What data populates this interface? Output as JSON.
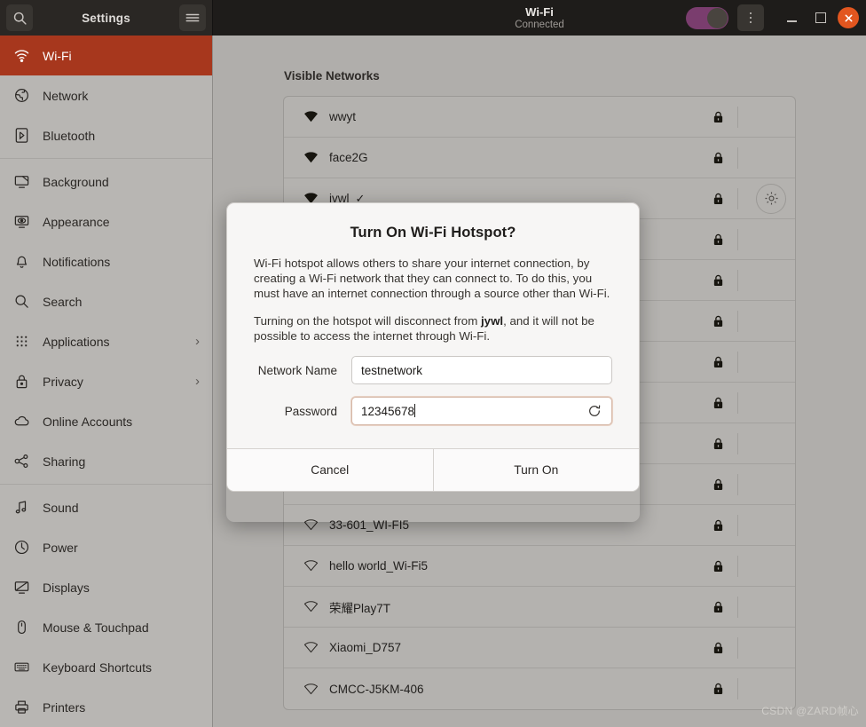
{
  "titlebar": {
    "app_title": "Settings",
    "search_icon": "search-icon",
    "menu_icon": "hamburger-icon",
    "page_title": "Wi-Fi",
    "page_subtitle": "Connected",
    "toggle_state": "on",
    "toggle_color": "#7a3d6e",
    "more_icon": "kebab-menu-icon",
    "minimize_icon": "minimize-icon",
    "maximize_icon": "maximize-icon",
    "close_icon": "close-icon",
    "close_color": "#e2561f"
  },
  "sidebar": {
    "selected": "Wi-Fi",
    "selected_color": "#a7371d",
    "items": [
      {
        "label": "Wi-Fi",
        "icon": "wifi-icon",
        "selected": true
      },
      {
        "label": "Network",
        "icon": "globe-icon"
      },
      {
        "label": "Bluetooth",
        "icon": "bluetooth-icon"
      },
      {
        "separator": true
      },
      {
        "label": "Background",
        "icon": "background-monitor-icon"
      },
      {
        "label": "Appearance",
        "icon": "appearance-icon"
      },
      {
        "label": "Notifications",
        "icon": "bell-icon"
      },
      {
        "label": "Search",
        "icon": "search-icon"
      },
      {
        "label": "Applications",
        "icon": "grid-dots-icon",
        "chevron": "›"
      },
      {
        "label": "Privacy",
        "icon": "lock-icon",
        "chevron": "›"
      },
      {
        "label": "Online Accounts",
        "icon": "cloud-icon"
      },
      {
        "label": "Sharing",
        "icon": "share-nodes-icon"
      },
      {
        "separator": true
      },
      {
        "label": "Sound",
        "icon": "music-note-icon"
      },
      {
        "label": "Power",
        "icon": "power-icon"
      },
      {
        "label": "Displays",
        "icon": "displays-icon"
      },
      {
        "label": "Mouse & Touchpad",
        "icon": "mouse-icon"
      },
      {
        "label": "Keyboard Shortcuts",
        "icon": "keyboard-icon"
      },
      {
        "label": "Printers",
        "icon": "printer-icon"
      }
    ]
  },
  "main": {
    "section_title": "Visible Networks",
    "networks": [
      {
        "name": "wwyt",
        "signal": "strong",
        "secured": true,
        "connected": false
      },
      {
        "name": "face2G",
        "signal": "strong",
        "secured": true,
        "connected": false
      },
      {
        "name": "jvwl",
        "signal": "strong",
        "secured": true,
        "connected": true,
        "check": "✓",
        "settings_icon": "gear-icon"
      },
      {
        "name": "",
        "signal": "strong",
        "secured": true,
        "connected": false
      },
      {
        "name": "",
        "signal": "strong",
        "secured": true,
        "connected": false
      },
      {
        "name": "",
        "signal": "strong",
        "secured": true,
        "connected": false
      },
      {
        "name": "",
        "signal": "weak",
        "secured": true,
        "connected": false
      },
      {
        "name": "",
        "signal": "weak",
        "secured": true,
        "connected": false
      },
      {
        "name": "",
        "signal": "weak",
        "secured": true,
        "connected": false
      },
      {
        "name": "",
        "signal": "weak",
        "secured": true,
        "connected": false
      },
      {
        "name": "33-601_WI-FI5",
        "signal": "weak",
        "secured": true,
        "connected": false
      },
      {
        "name": "hello world_Wi-Fi5",
        "signal": "weak",
        "secured": true,
        "connected": false
      },
      {
        "name": "荣耀Play7T",
        "signal": "weak",
        "secured": true,
        "connected": false
      },
      {
        "name": "Xiaomi_D757",
        "signal": "weak",
        "secured": true,
        "connected": false
      },
      {
        "name": "CMCC-J5KM-406",
        "signal": "weak",
        "secured": true,
        "connected": false
      }
    ]
  },
  "dialog": {
    "title": "Turn On Wi-Fi Hotspot?",
    "paragraph1": "Wi-Fi hotspot allows others to share your internet connection, by creating a Wi-Fi network that they can connect to. To do this, you must have an internet connection through a source other than Wi-Fi.",
    "paragraph2_before": "Turning on the hotspot will disconnect from ",
    "paragraph2_bold": "jywl",
    "paragraph2_after": ", and it will not be possible to access the internet through Wi-Fi.",
    "network_name_label": "Network Name",
    "network_name_value": "testnetwork",
    "password_label": "Password",
    "password_value": "12345678",
    "regenerate_icon": "refresh-icon",
    "cancel_label": "Cancel",
    "confirm_label": "Turn On"
  },
  "watermark": "CSDN @ZARD帧心"
}
